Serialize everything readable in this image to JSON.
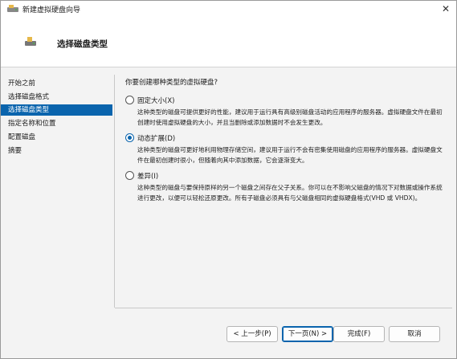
{
  "window": {
    "title": "新建虚拟硬盘向导",
    "close_glyph": "✕"
  },
  "header": {
    "title": "选择磁盘类型"
  },
  "sidebar": {
    "items": [
      {
        "label": "开始之前"
      },
      {
        "label": "选择磁盘格式"
      },
      {
        "label": "选择磁盘类型"
      },
      {
        "label": "指定名称和位置"
      },
      {
        "label": "配置磁盘"
      },
      {
        "label": "摘要"
      }
    ],
    "active_index": 2
  },
  "main": {
    "question": "你要创建哪种类型的虚拟硬盘?",
    "options": [
      {
        "label": "固定大小(X)",
        "checked": false,
        "desc1": "这种类型的磁盘可提供更好的性能，建议用于运行具有高级别磁盘活动的应用程序的服务器。虚拟硬盘文件在最初",
        "desc2": "创建时使用虚拟硬盘的大小，并且当删除或添加数据时不会发生更改。"
      },
      {
        "label": "动态扩展(D)",
        "checked": true,
        "desc1": "这种类型的磁盘可更好地利用物理存储空间，建议用于运行不会有密集使用磁盘的应用程序的服务器。虚拟硬盘文",
        "desc2": "件在最初创建时很小，但随着向其中添加数据，它会逐渐变大。"
      },
      {
        "label": "差异(I)",
        "checked": false,
        "desc1": "这种类型的磁盘与要保持原样的另一个磁盘之间存在父子关系。你可以在不影响父磁盘的情况下对数据或操作系统",
        "desc2": "进行更改，以便可以轻松还原更改。所有子磁盘必须具有与父磁盘相同的虚拟硬盘格式(VHD 或 VHDX)。"
      }
    ]
  },
  "footer": {
    "prev": "< 上一步(P)",
    "next": "下一页(N) >",
    "finish": "完成(F)",
    "cancel": "取消"
  },
  "colors": {
    "accent": "#0a64ad",
    "window_bg": "#f3f3f3"
  }
}
